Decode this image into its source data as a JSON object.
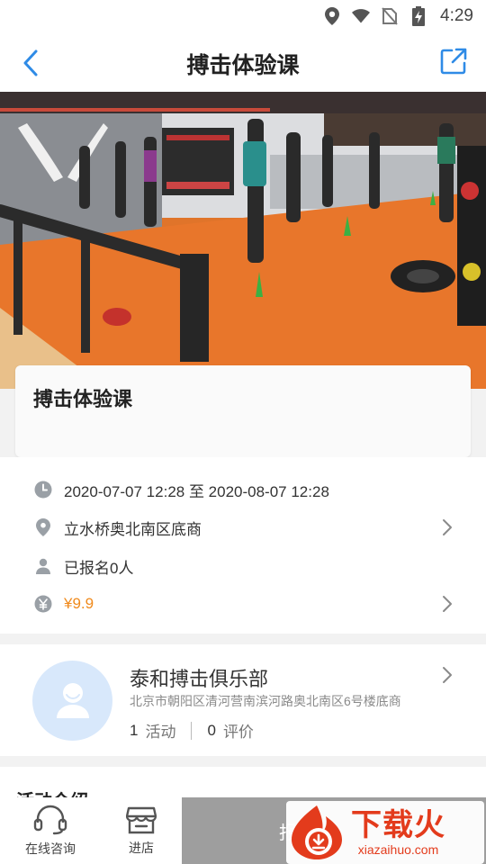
{
  "status_bar": {
    "time": "4:29",
    "icons": [
      "location-icon",
      "wifi-icon",
      "no-sim-icon",
      "battery-charging-icon"
    ]
  },
  "nav": {
    "title": "搏击体验课",
    "back_icon": "chevron-left-icon",
    "share_icon": "share-icon"
  },
  "course": {
    "title": "搏击体验课",
    "datetime": "2020-07-07 12:28 至 2020-08-07 12:28",
    "location": "立水桥奥北南区底商",
    "enrolled": "已报名0人",
    "price": "¥9.9"
  },
  "club": {
    "name": "泰和搏击俱乐部",
    "address": "北京市朝阳区清河营南滨河路奥北南区6号楼底商",
    "activities_count": "1",
    "activities_label": "活动",
    "reviews_count": "0",
    "reviews_label": "评价"
  },
  "intro": {
    "heading": "活动介绍"
  },
  "bottom_bar": {
    "consult_label": "在线咨询",
    "store_label": "进店",
    "signup_label": "报名"
  },
  "watermark": {
    "brand": "下载火",
    "domain": "xiazaihuo.com"
  },
  "colors": {
    "accent_blue": "#2f8be6",
    "price_orange": "#f08a1c",
    "button_gray": "#9e9e9e",
    "watermark_red": "#e33b1c"
  }
}
